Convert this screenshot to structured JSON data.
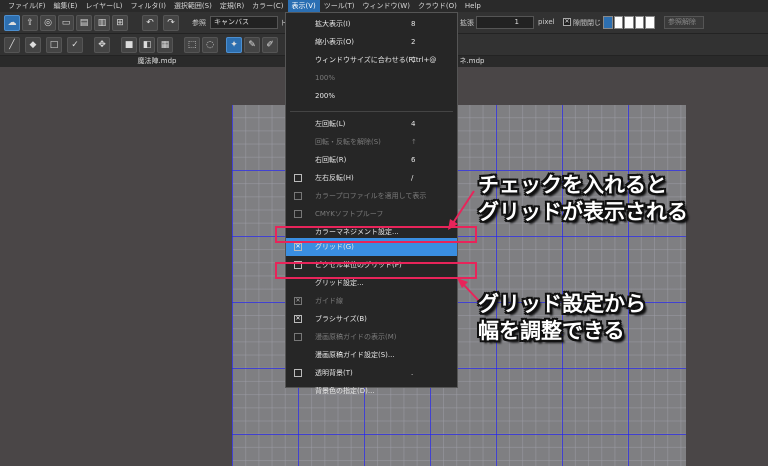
{
  "menubar": [
    {
      "label": "ファイル(F)",
      "active": false
    },
    {
      "label": "編集(E)",
      "active": false
    },
    {
      "label": "レイヤー(L)",
      "active": false
    },
    {
      "label": "フィルタ(I)",
      "active": false
    },
    {
      "label": "選択範囲(S)",
      "active": false
    },
    {
      "label": "定規(R)",
      "active": false
    },
    {
      "label": "カラー(C)",
      "active": false
    },
    {
      "label": "表示(V)",
      "active": true
    },
    {
      "label": "ツール(T)",
      "active": false
    },
    {
      "label": "ウィンドウ(W)",
      "active": false
    },
    {
      "label": "クラウド(O)",
      "active": false
    },
    {
      "label": "Help",
      "active": false
    }
  ],
  "toolbar": {
    "ref_label": "参照",
    "ref_value": "キャンバス",
    "r_label": "ト",
    "expand_label": "拡張",
    "expand_value": "1",
    "unit": "pixel",
    "gap_close_label": "隙間閉じ",
    "unlock_label": "参照解除",
    "undo_icon": "undo-icon",
    "redo_icon": "redo-icon"
  },
  "tabs": {
    "doc1": "魔法陣.mdp",
    "doc2": "ネ.mdp"
  },
  "view_menu": [
    {
      "label": "拡大表示(I)",
      "shortcut": "8",
      "check": "none",
      "disabled": false
    },
    {
      "label": "縮小表示(O)",
      "shortcut": "2",
      "check": "none",
      "disabled": false
    },
    {
      "label": "ウィンドウサイズに合わせる(F)",
      "shortcut": "Ctrl+@",
      "check": "none",
      "disabled": false
    },
    {
      "label": "100%",
      "shortcut": "",
      "check": "none",
      "disabled": true
    },
    {
      "label": "200%",
      "shortcut": "",
      "check": "none",
      "disabled": false
    },
    {
      "label": "左回転(L)",
      "shortcut": "4",
      "check": "none",
      "disabled": false
    },
    {
      "label": "回転・反転を解除(S)",
      "shortcut": "↑",
      "check": "none",
      "disabled": true
    },
    {
      "label": "右回転(R)",
      "shortcut": "6",
      "check": "none",
      "disabled": false
    },
    {
      "label": "左右反転(H)",
      "shortcut": "/",
      "check": "empty",
      "disabled": false
    },
    {
      "label": "カラープロファイルを適用して表示",
      "shortcut": "",
      "check": "empty",
      "disabled": true
    },
    {
      "label": "CMYKソフトプルーフ",
      "shortcut": "",
      "check": "empty",
      "disabled": true
    },
    {
      "label": "カラーマネジメント設定...",
      "shortcut": "",
      "check": "none",
      "disabled": false
    },
    {
      "label": "グリッド(G)",
      "shortcut": "",
      "check": "checked",
      "disabled": false
    },
    {
      "label": "ピクセル単位のグリッド(P)",
      "shortcut": "",
      "check": "empty",
      "disabled": false
    },
    {
      "label": "グリッド設定...",
      "shortcut": "",
      "check": "none",
      "disabled": false
    },
    {
      "label": "ガイド線",
      "shortcut": "",
      "check": "checked",
      "disabled": true
    },
    {
      "label": "ブラシサイズ(B)",
      "shortcut": "",
      "check": "checked",
      "disabled": false
    },
    {
      "label": "漫画原稿ガイドの表示(M)",
      "shortcut": "",
      "check": "empty",
      "disabled": true
    },
    {
      "label": "漫画原稿ガイド設定(S)...",
      "shortcut": "",
      "check": "none",
      "disabled": false
    },
    {
      "label": "透明背景(T)",
      "shortcut": ".",
      "check": "empty",
      "disabled": false
    },
    {
      "label": "背景色の指定(D)...",
      "shortcut": "",
      "check": "none",
      "disabled": false
    }
  ],
  "annotations": {
    "top_line1": "チェックを入れると",
    "top_line2": "グリッドが表示される",
    "bottom_line1": "グリッド設定から",
    "bottom_line2": "幅を調整できる"
  },
  "colors": {
    "highlight": "#3a8ee0",
    "annotation_red": "#e8245a",
    "grid_major": "#2828e6",
    "canvas_paper": "#7f7f82"
  }
}
